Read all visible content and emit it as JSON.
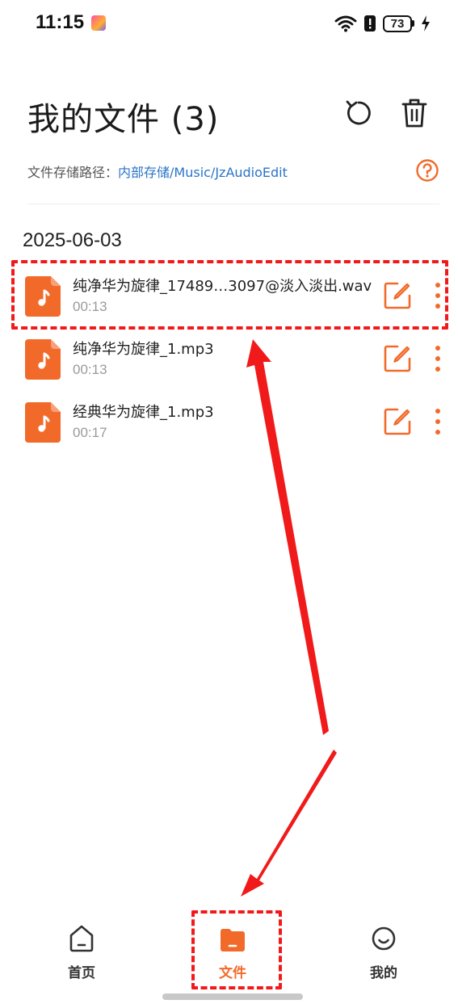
{
  "status_bar": {
    "time": "11:15",
    "battery": "73",
    "icons": [
      "app-icon",
      "wifi-icon",
      "alert-icon",
      "battery-icon",
      "charging-icon"
    ]
  },
  "header": {
    "title": "我的文件 (3)",
    "refresh_icon": "refresh-icon",
    "delete_icon": "trash-icon"
  },
  "storage": {
    "label": "文件存储路径：",
    "path": "内部存储/Music/JzAudioEdit",
    "help_icon": "help-icon"
  },
  "date_group": "2025-06-03",
  "files": [
    {
      "name": "纯净华为旋律_17489…3097@淡入淡出.wav",
      "duration": "00:13"
    },
    {
      "name": "纯净华为旋律_1.mp3",
      "duration": "00:13"
    },
    {
      "name": "经典华为旋律_1.mp3",
      "duration": "00:17"
    }
  ],
  "bottom_nav": {
    "items": [
      {
        "label": "首页",
        "icon": "home-icon"
      },
      {
        "label": "文件",
        "icon": "folder-icon",
        "active": true
      },
      {
        "label": "我的",
        "icon": "smile-icon"
      }
    ]
  },
  "colors": {
    "accent": "#f26a2a",
    "link": "#2a74c9",
    "annotation": "#f11a1a"
  }
}
